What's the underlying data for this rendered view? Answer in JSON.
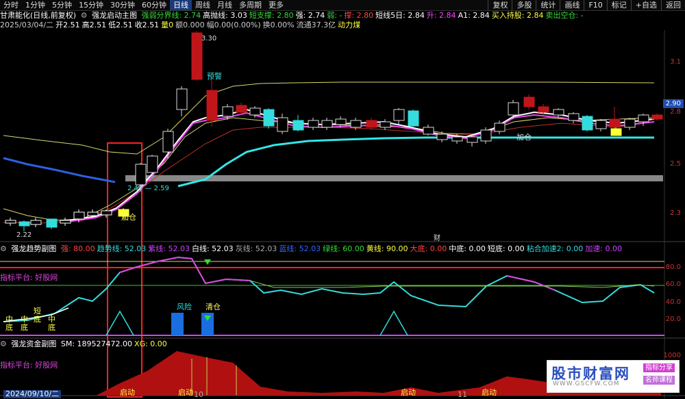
{
  "toolbar": {
    "timeframes": [
      "分时",
      "1分钟",
      "5分钟",
      "15分钟",
      "30分钟",
      "60分钟",
      "日线",
      "周线",
      "月线",
      "多周期",
      "更多"
    ],
    "active": "日线",
    "tools": [
      "复权",
      "多股",
      "统计",
      "画线",
      "F10",
      "标记",
      "+自选",
      "返回"
    ]
  },
  "main_header": {
    "stock": "甘肃能化(日线,前复权)",
    "indicator": "强龙启动主图",
    "items": [
      {
        "text": "强弱分界线: 2.74",
        "color": "#33dd33"
      },
      {
        "text": "高抛线: 3.03",
        "color": "#ffffff"
      },
      {
        "text": "短支撑: 2.80",
        "color": "#33dd33"
      },
      {
        "text": "强: 2.74",
        "color": "#ffffff"
      },
      {
        "text": "弱: -",
        "color": "#33dd33"
      },
      {
        "text": "撑: 2.80",
        "color": "#ff4444"
      },
      {
        "text": "短线5日: 2.84",
        "color": "#ffffff"
      },
      {
        "text": "升: 2.84",
        "color": "#ff44ff"
      },
      {
        "text": "A1: 2.84",
        "color": "#ffffff"
      },
      {
        "text": "买入持股: 2.84",
        "color": "#ffff44"
      },
      {
        "text": "卖出空仓: -",
        "color": "#33dd33"
      }
    ]
  },
  "quote": {
    "items": [
      {
        "text": "2025/03/04/二",
        "color": "#cccccc"
      },
      {
        "text": "开2.51",
        "color": "#ffffff"
      },
      {
        "text": "高2.51",
        "color": "#ffffff"
      },
      {
        "text": "低2.51",
        "color": "#ffffff"
      },
      {
        "text": "收2.51",
        "color": "#ffffff"
      },
      {
        "text": "量0",
        "color": "#ffff44"
      },
      {
        "text": "额0.000",
        "color": "#cccccc"
      },
      {
        "text": "幅0.00(0.00%)",
        "color": "#cccccc"
      },
      {
        "text": "换0.00%",
        "color": "#cccccc"
      },
      {
        "text": "流通37.3亿",
        "color": "#cccccc"
      },
      {
        "text": "动力煤",
        "color": "#ffff44"
      }
    ]
  },
  "price_axis": [
    "3.1",
    "2.8",
    "2.5",
    "2.3"
  ],
  "price_badge": "2.90",
  "annotations": {
    "high": "3.30",
    "low": "2.22",
    "warn": "预警",
    "add": "加仓",
    "add2": "加仓",
    "levels": "2.49 — 2.59",
    "cai": "财"
  },
  "sub1_header": {
    "indicator": "强龙趋势副图",
    "items": [
      {
        "text": "强: 80.00",
        "color": "#ff4444"
      },
      {
        "text": "趋势线: 52.03",
        "color": "#33dddd"
      },
      {
        "text": "紫线: 52.03",
        "color": "#cc44ff"
      },
      {
        "text": "白线: 52.03",
        "color": "#ffffff"
      },
      {
        "text": "灰线: 52.03",
        "color": "#aaaaaa"
      },
      {
        "text": "蓝线: 52.03",
        "color": "#3366ff"
      },
      {
        "text": "绿线: 60.00",
        "color": "#33dd33"
      },
      {
        "text": "黄线: 90.00",
        "color": "#ffff44"
      },
      {
        "text": "大底: 0.00",
        "color": "#ff4444"
      },
      {
        "text": "中底: 0.00",
        "color": "#ffffff"
      },
      {
        "text": "短底: 0.00",
        "color": "#ffffff"
      },
      {
        "text": "粘合加速2: 0.00",
        "color": "#33dddd"
      },
      {
        "text": "加速: 0.00",
        "color": "#cc44ff"
      }
    ]
  },
  "sub1_axis": [
    "80.0",
    "60.0",
    "40.0",
    "20.0"
  ],
  "sub1_side": "指标平台: 好股网",
  "sub1_marks": {
    "risk": "风险",
    "clear": "清仓",
    "zhong1": "中",
    "di1": "底",
    "zhong2": "中",
    "di2": "底",
    "duan": "短",
    "zhong3": "中",
    "di3": "底",
    "di4": "底"
  },
  "sub2_header": {
    "indicator": "强龙资金副图",
    "items": [
      {
        "text": "SM: 189527472.00",
        "color": "#ffffff"
      },
      {
        "text": "XG: 0.00",
        "color": "#ffff44"
      }
    ]
  },
  "sub2_axis": [
    "1000"
  ],
  "sub2_side": "指标平台: 好股网",
  "qidong": "启动",
  "date_bar": "2024/09/10/二",
  "date_mid": "10",
  "date_mid2": "11",
  "watermark": {
    "title": "股市财富网",
    "url": "WWW.GSCFW.COM",
    "tag1": "指标分享",
    "tag2": "名师课程"
  }
}
